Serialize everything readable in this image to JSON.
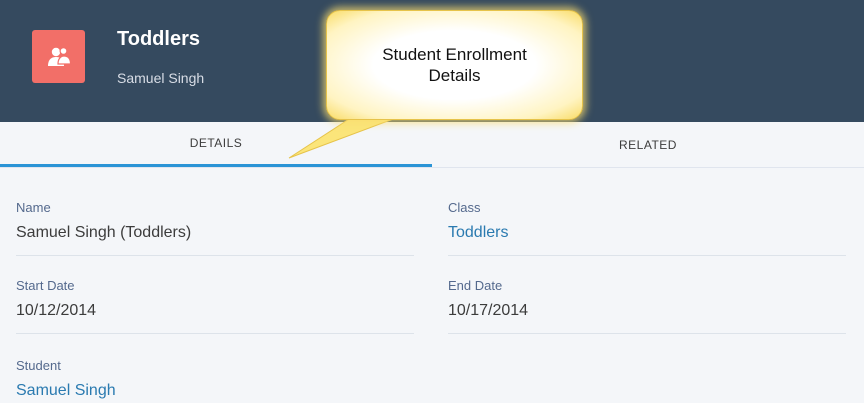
{
  "header": {
    "icon": "people-icon",
    "title": "Toddlers",
    "subtitle": "Samuel Singh",
    "background": "#354a5f",
    "icon_color": "#f26f68"
  },
  "tabs": [
    {
      "label": "DETAILS",
      "active": true
    },
    {
      "label": "RELATED",
      "active": false
    }
  ],
  "fields": {
    "name": {
      "label": "Name",
      "value": "Samuel Singh (Toddlers)"
    },
    "class": {
      "label": "Class",
      "value": "Toddlers"
    },
    "start_date": {
      "label": "Start Date",
      "value": "10/12/2014"
    },
    "end_date": {
      "label": "End Date",
      "value": "10/17/2014"
    },
    "student": {
      "label": "Student",
      "value": "Samuel Singh"
    }
  },
  "callout": {
    "text": "Student Enrollment Details"
  },
  "colors": {
    "accent": "#2a94d6",
    "link": "#2a7ab0"
  }
}
